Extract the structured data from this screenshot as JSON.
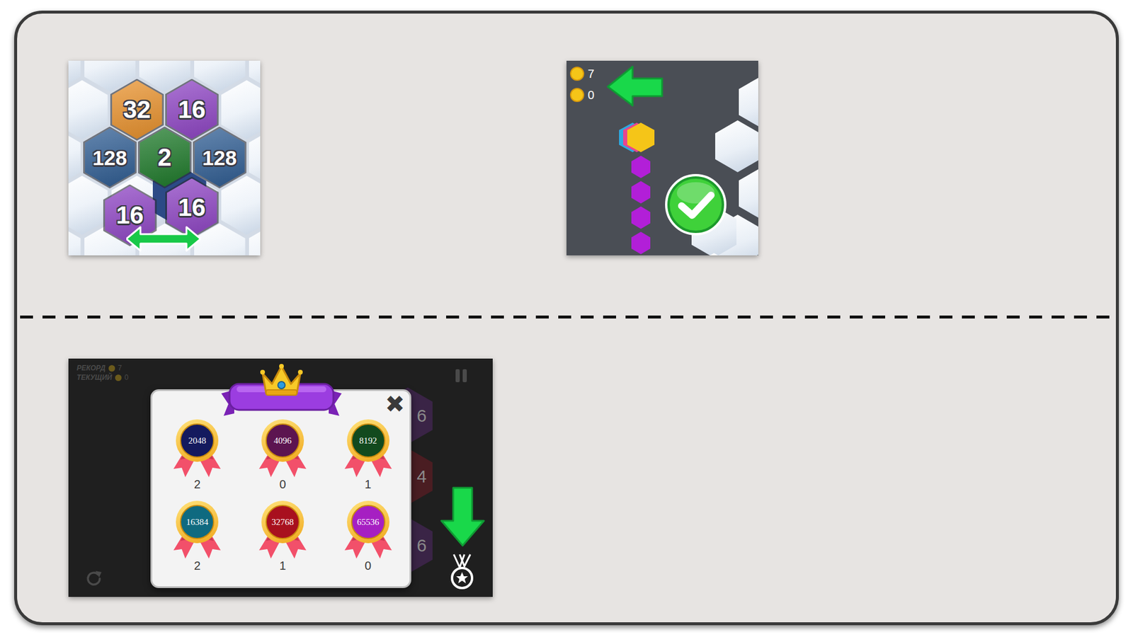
{
  "merge_hint": {
    "tiles": [
      {
        "value": "32",
        "color": "#e8912c"
      },
      {
        "value": "16",
        "color": "#8e44c4"
      },
      {
        "value": "128",
        "color": "#2f5d93"
      },
      {
        "value": "2",
        "color": "#1e7a2a"
      },
      {
        "value": "128",
        "color": "#2f5d93"
      },
      {
        "value": "16",
        "color": "#8e44c4"
      },
      {
        "value": "16",
        "color": "#8e44c4"
      }
    ]
  },
  "coins_hint": {
    "coins": [
      {
        "value": "7"
      },
      {
        "value": "0"
      }
    ],
    "stack": [
      {
        "color": "#2ea8e0"
      },
      {
        "color": "#e8458f"
      },
      {
        "color": "#f5c518"
      }
    ],
    "trail": [
      {
        "color": "#b21fd8"
      },
      {
        "color": "#b21fd8"
      },
      {
        "color": "#b21fd8"
      },
      {
        "color": "#b21fd8"
      }
    ]
  },
  "medals_screen": {
    "stats": [
      {
        "label": "РЕКОРД",
        "value": "7"
      },
      {
        "label": "ТЕКУЩИЙ",
        "value": "0"
      }
    ],
    "board_tiles": [
      {
        "value": "6",
        "color": "#3a2446"
      },
      {
        "value": "4",
        "color": "#4a1d22"
      },
      {
        "value": "6",
        "color": "#3a2446"
      }
    ],
    "dialog": {
      "close": "✖",
      "medals": [
        {
          "value": "2048",
          "count": "2",
          "color": "#141a5e"
        },
        {
          "value": "4096",
          "count": "0",
          "color": "#5c1450"
        },
        {
          "value": "8192",
          "count": "1",
          "color": "#124a1e"
        },
        {
          "value": "16384",
          "count": "2",
          "color": "#0f6a80"
        },
        {
          "value": "32768",
          "count": "1",
          "color": "#a8101e"
        },
        {
          "value": "65536",
          "count": "0",
          "color": "#a61fc2"
        }
      ]
    }
  }
}
